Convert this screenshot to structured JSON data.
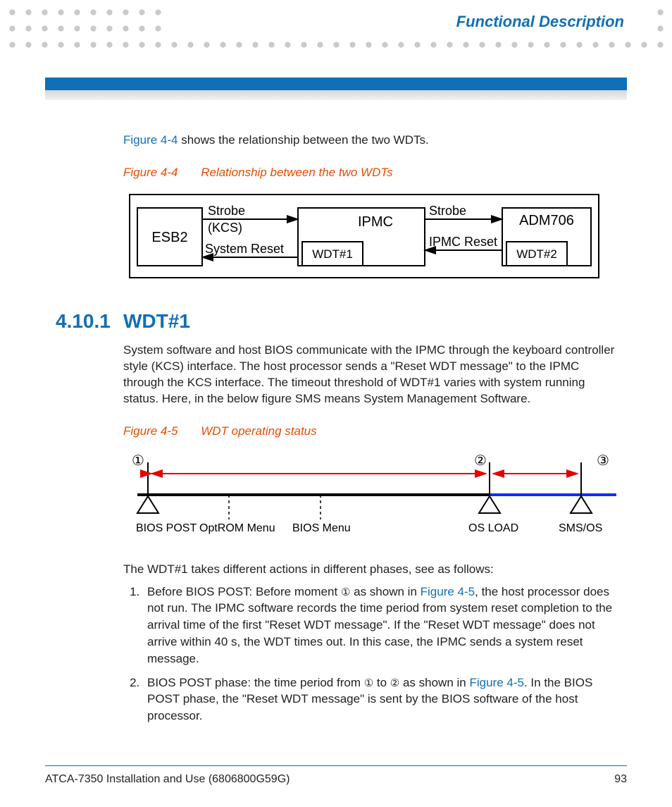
{
  "header": {
    "section": "Functional Description"
  },
  "intro": {
    "link_text": "Figure 4-4",
    "tail": " shows the relationship between the two WDTs."
  },
  "figure44": {
    "num": "Figure 4-4",
    "title": "Relationship between the two WDTs",
    "blocks": {
      "esb2": "ESB2",
      "ipmc": "IPMC",
      "wdt1": "WDT#1",
      "adm706": "ADM706",
      "wdt2": "WDT#2"
    },
    "arrows": {
      "strobe1_a": "Strobe",
      "strobe1_b": "(KCS)",
      "sysreset": "System Reset",
      "strobe2": "Strobe",
      "ipmcreset": "IPMC Reset"
    }
  },
  "section": {
    "num": "4.10.1",
    "title": "WDT#1",
    "para": "System software and host BIOS communicate with the IPMC through the keyboard controller style (KCS) interface. The host processor sends a \"Reset WDT message\" to the IPMC through the KCS interface. The timeout threshold of WDT#1 varies with system running status. Here, in the below figure SMS means System Management Software."
  },
  "figure45": {
    "num": "Figure 4-5",
    "title": "WDT operating status",
    "labels": {
      "bios_post": "BIOS POST",
      "optrom": "OptROM Menu",
      "bios_menu": "BIOS Menu",
      "os_load": "OS LOAD",
      "sms_os": "SMS/OS"
    },
    "circles": {
      "c1": "①",
      "c2": "②",
      "c3": "③"
    }
  },
  "after_fig5": {
    "lead": "The WDT#1 takes different actions in different phases, see as follows:",
    "item1_a": "Before BIOS POST: Before moment ",
    "item1_circ": "①",
    "item1_b": " as shown in ",
    "item1_link": "Figure 4-5",
    "item1_c": ", the host processor does not run. The IPMC software records the time period from system reset completion to the arrival time of the first \"Reset WDT message\". If the \"Reset WDT message\" does not arrive within 40 s, the WDT times out. In this case, the IPMC sends a system reset message.",
    "item2_a": "BIOS POST phase: the time period from ",
    "item2_c1": "①",
    "item2_b": " to ",
    "item2_c2": "②",
    "item2_c": " as shown in ",
    "item2_link": "Figure 4-5",
    "item2_d": ". In the BIOS POST phase, the \"Reset WDT message\" is sent by the BIOS software of the host processor."
  },
  "footer": {
    "doc": "ATCA-7350 Installation and Use (6806800G59G)",
    "page": "93"
  }
}
